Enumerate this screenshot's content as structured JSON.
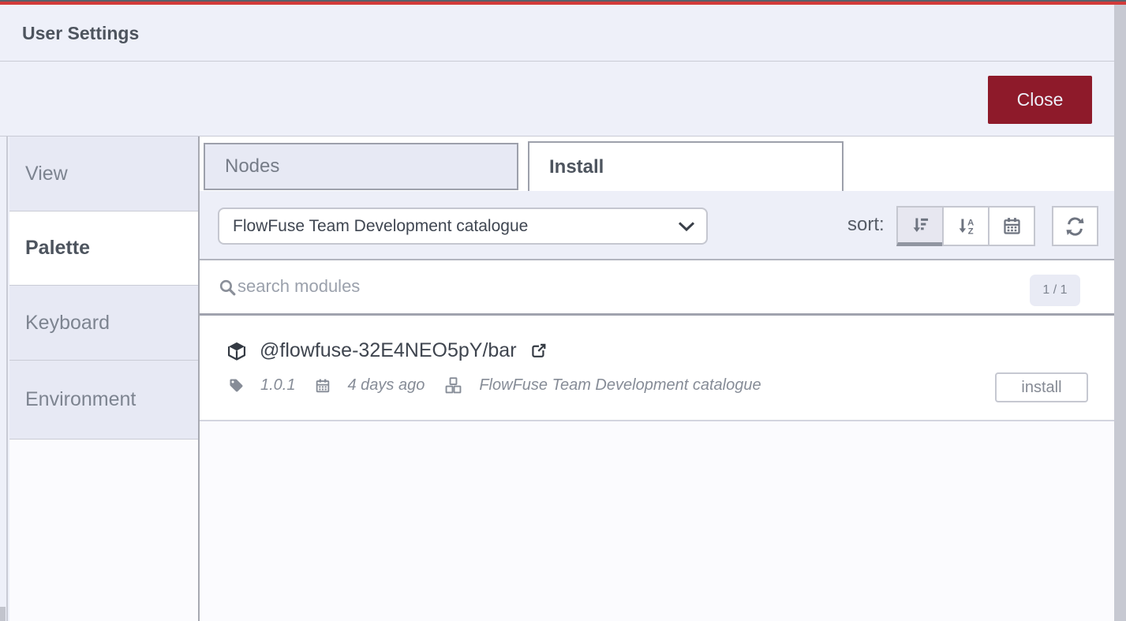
{
  "dialog": {
    "title": "User Settings",
    "close_label": "Close"
  },
  "sidebar": {
    "items": [
      {
        "label": "View",
        "selected": false
      },
      {
        "label": "Palette",
        "selected": true
      },
      {
        "label": "Keyboard",
        "selected": false
      },
      {
        "label": "Environment",
        "selected": false
      }
    ]
  },
  "palette": {
    "tabs": [
      {
        "label": "Nodes",
        "selected": false
      },
      {
        "label": "Install",
        "selected": true
      }
    ],
    "toolbar": {
      "catalogue_selected": "FlowFuse Team Development catalogue",
      "sort_label": "sort:"
    },
    "search": {
      "placeholder": "search modules",
      "count": "1 / 1"
    },
    "modules": [
      {
        "name": "@flowfuse-32E4NEO5pY/bar",
        "version": "1.0.1",
        "updated": "4 days ago",
        "catalogue": "FlowFuse Team Development catalogue",
        "install_label": "install"
      }
    ]
  },
  "colors": {
    "accent_red": "#d23b3a",
    "topbar_dark": "#5a6069",
    "close_button_bg": "#8e1a2a",
    "panel_bg": "#eef0f9",
    "selected_text": "#4d545e",
    "muted_text": "#868c97",
    "border_light": "#c9cbd5",
    "border_dark": "#9da0ab"
  }
}
